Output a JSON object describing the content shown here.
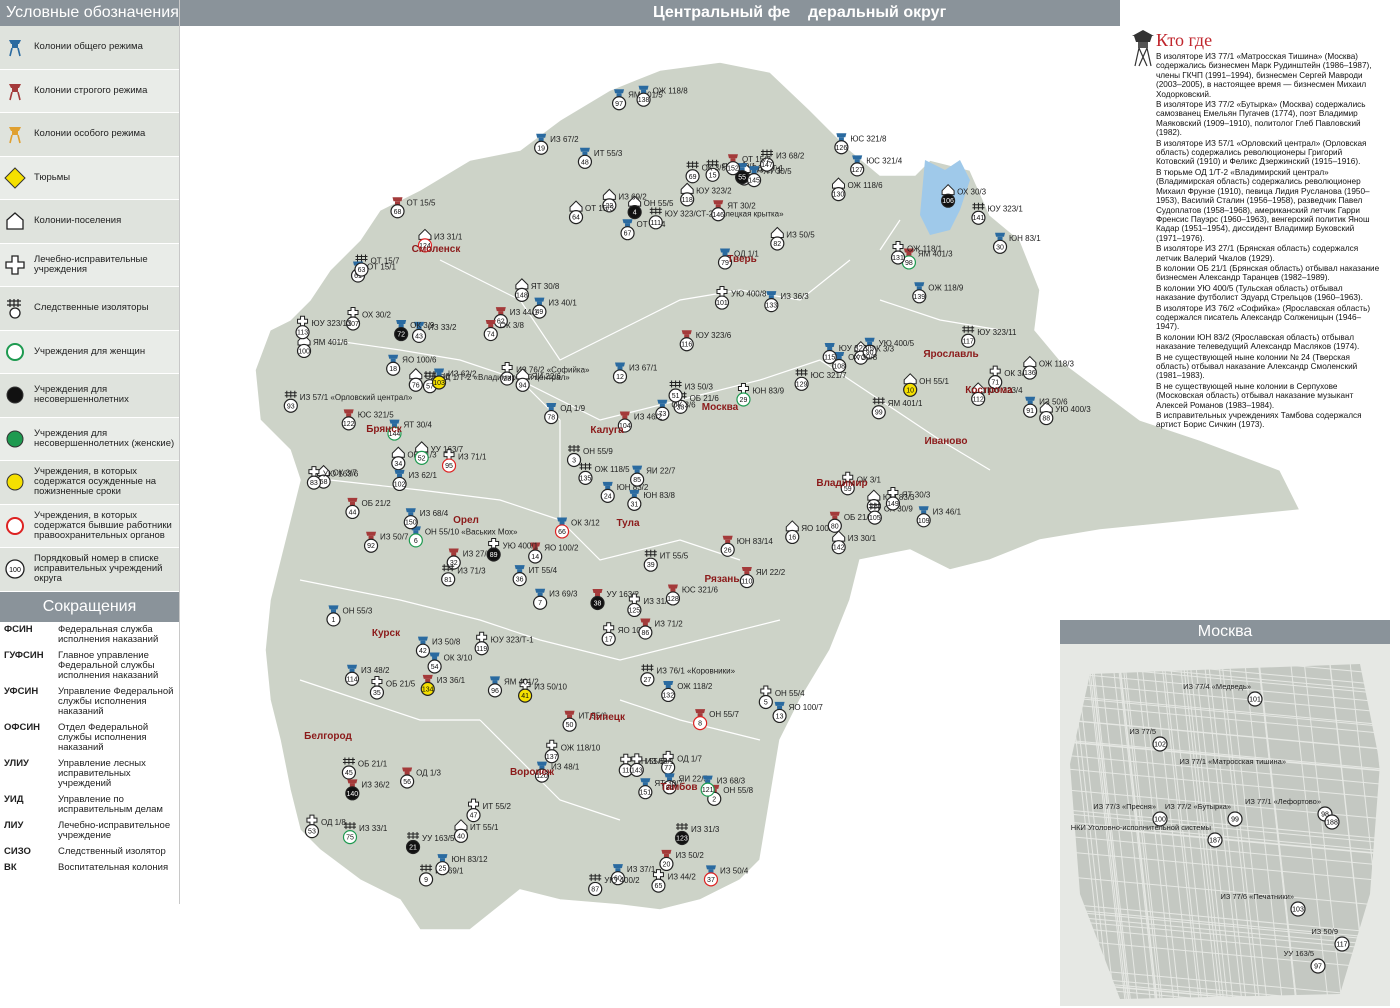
{
  "title_left": "Центральный фе",
  "title_right": "деральный округ",
  "legend": {
    "title": "Условные обозначения",
    "items": [
      {
        "label": "Колонии общего режима",
        "icon": "tower-blue-icon",
        "color": "#2a6aa0"
      },
      {
        "label": "Колонии строгого режима",
        "icon": "tower-red-icon",
        "color": "#a43a3a"
      },
      {
        "label": "Колонии особого режима",
        "icon": "tower-orange-icon",
        "color": "#e0a030"
      },
      {
        "label": "Тюрьмы",
        "icon": "diamond-yellow-icon",
        "color": "#f5e000"
      },
      {
        "label": "Колонии-поселения",
        "icon": "house-icon",
        "color": "#ffffff"
      },
      {
        "label": "Лечебно-исправительные учреждения",
        "icon": "cross-icon",
        "color": "#ffffff"
      },
      {
        "label": "Следственные изоляторы",
        "icon": "grid-circle-icon",
        "color": "#ffffff"
      },
      {
        "label": "Учреждения для женщин",
        "icon": "circle-green-ring-icon",
        "color": "#1e9a50"
      },
      {
        "label": "Учреждения для несовершеннолетних",
        "icon": "circle-black-icon",
        "color": "#111111"
      },
      {
        "label": "Учреждения для несовершеннолетних (женские)",
        "icon": "circle-green-icon",
        "color": "#1e9a50"
      },
      {
        "label": "Учреждения, в которых содержатся осужденные на пожизненные сроки",
        "icon": "circle-yellow-icon",
        "color": "#f5e000"
      },
      {
        "label": "Учреждения, в которых содержатся бывшие работники правоохранительных органов",
        "icon": "circle-red-ring-icon",
        "color": "#d22"
      },
      {
        "label": "Порядковый номер в списке исправительных учреждений округа",
        "icon": "number-circle-icon",
        "color": "#ffffff",
        "sample": "100"
      }
    ]
  },
  "abbreviations": {
    "title": "Сокращения",
    "items": [
      {
        "code": "ФСИН",
        "text": "Федеральная служба исполнения наказаний"
      },
      {
        "code": "ГУФСИН",
        "text": "Главное управление Федеральной службы исполнения наказаний"
      },
      {
        "code": "УФСИН",
        "text": "Управление Федеральной службы исполнения наказаний"
      },
      {
        "code": "ОФСИН",
        "text": "Отдел Федеральной службы исполнения наказаний"
      },
      {
        "code": "УЛИУ",
        "text": "Управление лесных исправительных учреждений"
      },
      {
        "code": "УИД",
        "text": "Управление по исправительным делам"
      },
      {
        "code": "ЛИУ",
        "text": "Лечебно-исправительное учреждение"
      },
      {
        "code": "СИЗО",
        "text": "Следственный изолятор"
      },
      {
        "code": "ВК",
        "text": "Воспитательная колония"
      }
    ]
  },
  "who_where": {
    "title": "Кто где",
    "paragraphs": [
      "В изоляторе ИЗ 77/1 «Матросская Тишина» (Москва) содержались бизнесмен Марк Рудинштейн (1986–1987), члены ГКЧП (1991–1994), бизнесмен Сергей Мавроди (2003–2005), в настоящее время — бизнесмен Михаил Ходорковский.",
      "В изоляторе ИЗ 77/2 «Бутырка» (Москва) содержались самозванец Емельян Пугачев (1774), поэт Владимир Маяковский (1909–1910), политолог Глеб Павловский (1982).",
      "В изоляторе ИЗ 57/1 «Орловский централ» (Орловская область) содержались революционеры Григорий Котовский (1910) и Феликс Дзержинский (1915–1916).",
      "В тюрьме ОД 1/Т-2 «Владимирский централ» (Владимирская область) содержались революционер Михаил Фрунзе (1910), певица Лидия Русланова (1950–1953), Василий Сталин (1956–1958), разведчик Павел Судоплатов (1958–1968), американский летчик Гарри Френсис Пауэрс (1960–1963), венгерский политик Янош Кадар (1951–1954), диссидент Владимир Буковский (1971–1976).",
      "В изоляторе ИЗ 27/1 (Брянская область) содержался летчик Валерий Чкалов (1929).",
      "В колонии ОБ 21/1 (Брянская область) отбывал наказание бизнесмен Александр Таранцев (1982–1989).",
      "В колонии УЮ 400/5 (Тульская область) отбывал наказание футболист Эдуард Стрельцов (1960–1963).",
      "В изоляторе ИЗ 76/2 «Софийка» (Ярославская область) содержался писатель Александр Солженицын (1946–1947).",
      "В колонии ЮН 83/2 (Ярославская область) отбывал наказание телеведущий Александр Масляков (1974).",
      "В не существующей ныне колонии № 24 (Тверская область) отбывал наказание Александр Смоленский (1981–1983).",
      "В не существующей ныне колонии в Серпухове (Московская область) отбывал наказание музыкант Алексей Романов (1983–1984).",
      "В исправительных учреждениях Тамбова содержался артист Борис Сичкин (1973)."
    ]
  },
  "moscow_inset": {
    "title": "Москва",
    "labels": [
      {
        "text": "ИЗ 77/5",
        "num": "102"
      },
      {
        "text": "ИЗ 77/4 «Медведь»",
        "num": "101"
      },
      {
        "text": "ИЗ 77/1 «Матросская тишина»",
        "num": ""
      },
      {
        "text": "ИЗ 77/3 «Пресня»",
        "num": "100"
      },
      {
        "text": "ИЗ 77/2 «Бутырка»",
        "num": "99"
      },
      {
        "text": "ИЗ 77/1 «Лефортово»",
        "num": "98"
      },
      {
        "text": "",
        "num": "188"
      },
      {
        "text": "НКИ Уголовно-исполнительной системы",
        "num": "187"
      },
      {
        "text": "ИЗ 77/6 «Печатники»",
        "num": "103"
      },
      {
        "text": "ИЗ 50/9",
        "num": "117"
      },
      {
        "text": "УУ 163/5",
        "num": "97"
      }
    ]
  },
  "cities": [
    "Смоленск",
    "Тверь",
    "Ярославль",
    "Кострома",
    "Иваново",
    "Владимир",
    "Москва",
    "Брянск",
    "Калуга",
    "Тула",
    "Рязань",
    "Орел",
    "Курск",
    "Липецк",
    "Тамбов",
    "Белгород",
    "Воронеж"
  ],
  "facility_labels": [
    "ОН 55/3",
    "ОН 55/8",
    "ОН 55/9",
    "ОН 55/5",
    "ОН 55/4",
    "ОН 55/10 «Ваських Мох»",
    "ИЗ 69/3",
    "ОН 55/7",
    "ИЗ 69/1",
    "ОН 55/1",
    "ОН 55/6",
    "ИЗ 67/1",
    "ЯО 100/7",
    "ЯО 100/2",
    "ЯО 100/1",
    "ЯО 100/3",
    "ЯО 100/5",
    "ЯО 100/6",
    "ИЗ 67/2",
    "ИЗ 50/2",
    "УУ 163/5",
    "ИЗ 69/2",
    "ИЗ 76/2 «Софийка»",
    "ЮН 83/2",
    "ЮН 83/12",
    "ЮН 83/14",
    "ИЗ 76/1 «Коровники»",
    "ЮН 83/3",
    "ЮН 83/9",
    "ЮН 83/1",
    "ЮН 83/8",
    "ИЗ 27/2",
    "ОБ 21/6",
    "ОБ 21/3",
    "ОБ 21/5",
    "ИТ 55/4",
    "ИЗ 50/4",
    "УУ 163/2",
    "ИТ 55/5",
    "ИТ 55/1",
    "ИЗ 50/10",
    "ИЗ 50/8",
    "ИЗ 33/2",
    "ОБ 21/2",
    "ОБ 21/1",
    "ИЗ 27/1",
    "ИТ 55/2",
    "ИТ 55/3",
    "ИЗ 40/1",
    "ИТ 55/6",
    "ИЗ 50/3",
    "УУ 163/7",
    "ОД 1/8",
    "ОК 3/10",
    "ОД 1/Т-1",
    "ОД 1/3",
    "ОД 1/Т-2 «Владимирский централ»",
    "ОК 3/7",
    "ОК 3/1",
    "ИЗ 37/1",
    "ОТ 15/1",
    "ИЗ 44/1",
    "ОТ 15/7",
    "ОТ 15/3",
    "ИЗ 44/2",
    "ОК 3/12",
    "ОТ 15/4",
    "ОТ 15/5",
    "ОК 3/5",
    "ОК 3/3",
    "ОК 3/4",
    "ОК 3/9",
    "ОК 3/6",
    "ОК 3/8",
    "ИЗ 33/1",
    "ОД 1/6",
    "ОД 1/7",
    "ОД 1/9",
    "ОД 1/1",
    "ОБ 21/4",
    "ИЗ 71/3",
    "ИЗ 50/5",
    "УЮ 163/6",
    "ЯИ 22/5",
    "ЯИ 22/7",
    "ИЗ 71/2",
    "УЮ 400/2",
    "УЮ 400/3",
    "УЮ 400/1",
    "УЮ 400/5",
    "ИЗ 50/6",
    "ИЗ 50/7",
    "ИЗ 57/1 «Орловский централ»",
    "ЯИ 22/6",
    "ИЗ 71/1",
    "ЯМ 401/2",
    "ЯМ 401/5",
    "ЯМ 401/3",
    "ЯМ 401/1",
    "ЯМ 401/6",
    "УЮ 400/8",
    "ИЗ 62/1",
    "ИЗ 62/2",
    "ИЗ 46/2",
    "ОХ 30/9",
    "ОХ 30/3",
    "ОХ 30/2",
    "ОХ 30/8",
    "ИЗ 46/1",
    "ЯИ 22/2",
    "ЮУ 323/СТ-2 «Елецкая крытка»",
    "ЮУ 323/4",
    "ЮУ 323/13",
    "ИЗ 48/2",
    "ЮУ 323/5",
    "ЮУ 323/6",
    "ЮУ 323/11",
    "ЮУ 323/2",
    "ЮУ 323/Т-1",
    "ИЗ 48/1",
    "ИЗ 68/3",
    "ЮС 321/5",
    "ИЗ 31/3",
    "ИЗ 31/1",
    "ИЗ 31/2",
    "ЮС 321/8",
    "ЮС 321/4",
    "ЮС 321/6",
    "ЮС 321/7",
    "ОЖ 118/6",
    "ОЖ 118/1",
    "ОЖ 118/2",
    "ИЗ 36/3",
    "ИЗ 36/1",
    "ОЖ 118/5",
    "ОЖ 118/3",
    "ОЖ 118/10",
    "ОЖ 118/8",
    "ОЖ 118/9",
    "ИЗ 36/2",
    "ЮУ 323/1",
    "ИЗ 30/1",
    "ИЗ 68/1",
    "ЯТ 30/4",
    "ЯТ 30/5",
    "ЯТ 30/2",
    "ИЗ 68/2",
    "ЯТ 30/8",
    "ЯТ 30/3",
    "ИЗ 68/4",
    "ЯТ 30/7",
    "ОТ 15/2"
  ]
}
